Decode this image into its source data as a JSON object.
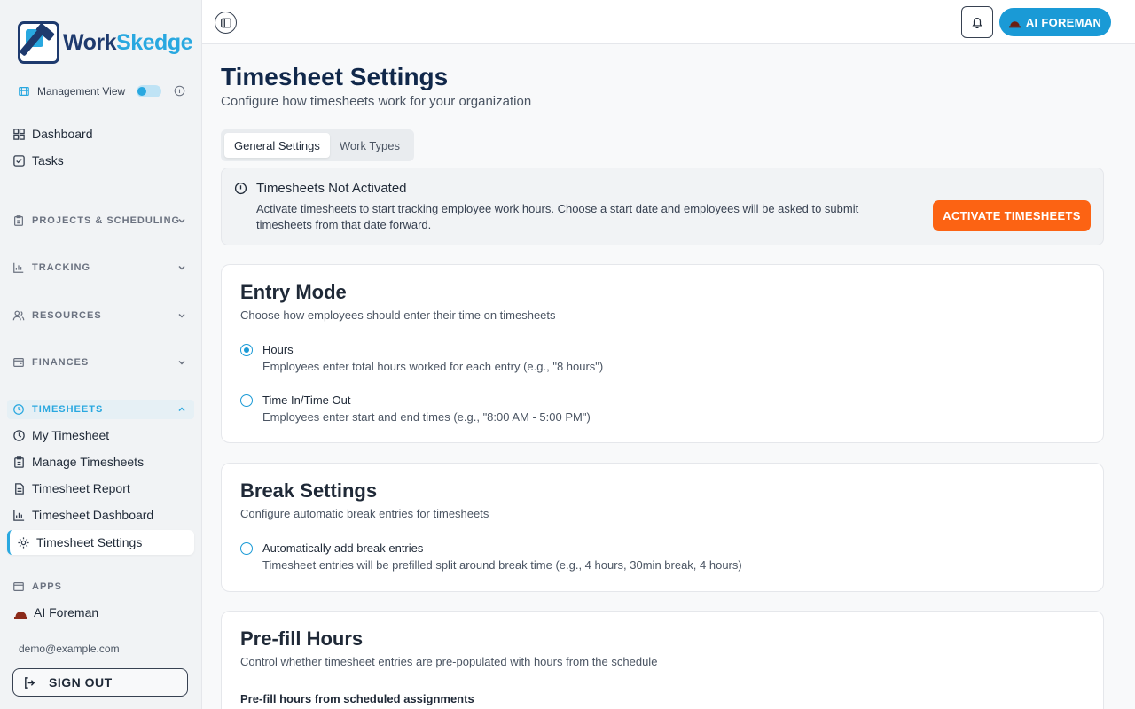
{
  "brand": {
    "name_part1": "Work",
    "name_part2": "Skedge"
  },
  "sidebar": {
    "management_view_label": "Management View",
    "items_top": [
      {
        "label": "Dashboard"
      },
      {
        "label": "Tasks"
      }
    ],
    "sections": {
      "projects": "PROJECTS & SCHEDULING",
      "tracking": "TRACKING",
      "resources": "RESOURCES",
      "finances": "FINANCES",
      "timesheets": "TIMESHEETS",
      "apps": "APPS"
    },
    "timesheet_items": [
      {
        "label": "My Timesheet"
      },
      {
        "label": "Manage Timesheets"
      },
      {
        "label": "Timesheet Report"
      },
      {
        "label": "Timesheet Dashboard"
      },
      {
        "label": "Timesheet Settings"
      }
    ],
    "apps_items": [
      {
        "label": "AI Foreman"
      }
    ],
    "email": "demo@example.com",
    "sign_out_label": "SIGN OUT"
  },
  "topbar": {
    "ai_button_label": "AI FOREMAN"
  },
  "main": {
    "title": "Timesheet Settings",
    "subtitle": "Configure how timesheets work for your organization",
    "tabs": [
      {
        "label": "General Settings"
      },
      {
        "label": "Work Types"
      }
    ],
    "alert": {
      "title": "Timesheets Not Activated",
      "body": "Activate timesheets to start tracking employee work hours. Choose a start date and employees will be asked to submit timesheets from that date forward.",
      "button_label": "ACTIVATE TIMESHEETS"
    },
    "entry_mode": {
      "title": "Entry Mode",
      "subtitle": "Choose how employees should enter their time on timesheets",
      "options": [
        {
          "label": "Hours",
          "description": "Employees enter total hours worked for each entry (e.g., \"8 hours\")"
        },
        {
          "label": "Time In/Time Out",
          "description": "Employees enter start and end times (e.g., \"8:00 AM - 5:00 PM\")"
        }
      ]
    },
    "break_settings": {
      "title": "Break Settings",
      "subtitle": "Configure automatic break entries for timesheets",
      "option": {
        "label": "Automatically add break entries",
        "description": "Timesheet entries will be prefilled split around break time (e.g., 4 hours, 30min break, 4 hours)"
      }
    },
    "prefill": {
      "title": "Pre-fill Hours",
      "subtitle": "Control whether timesheet entries are pre-populated with hours from the schedule",
      "field_label": "Pre-fill hours from scheduled assignments"
    }
  },
  "colors": {
    "accent": "#29a8e0",
    "brand_navy": "#1e3a6e",
    "activate": "#fc6313",
    "ai_button": "#1a9ad6"
  },
  "icons": {
    "management": "building-icon",
    "dashboard": "grid-icon",
    "tasks": "checkbox-icon",
    "projects": "clipboard-icon",
    "tracking": "bar-chart-icon",
    "resources": "users-icon",
    "finances": "wallet-icon",
    "timesheets": "clock-icon",
    "settings": "gear-icon",
    "apps": "window-icon",
    "ai_foreman": "hard-hat-icon",
    "sign_out": "logout-icon",
    "panel": "sidebar-toggle-icon",
    "bell": "bell-icon",
    "alert": "alert-circle-icon"
  }
}
